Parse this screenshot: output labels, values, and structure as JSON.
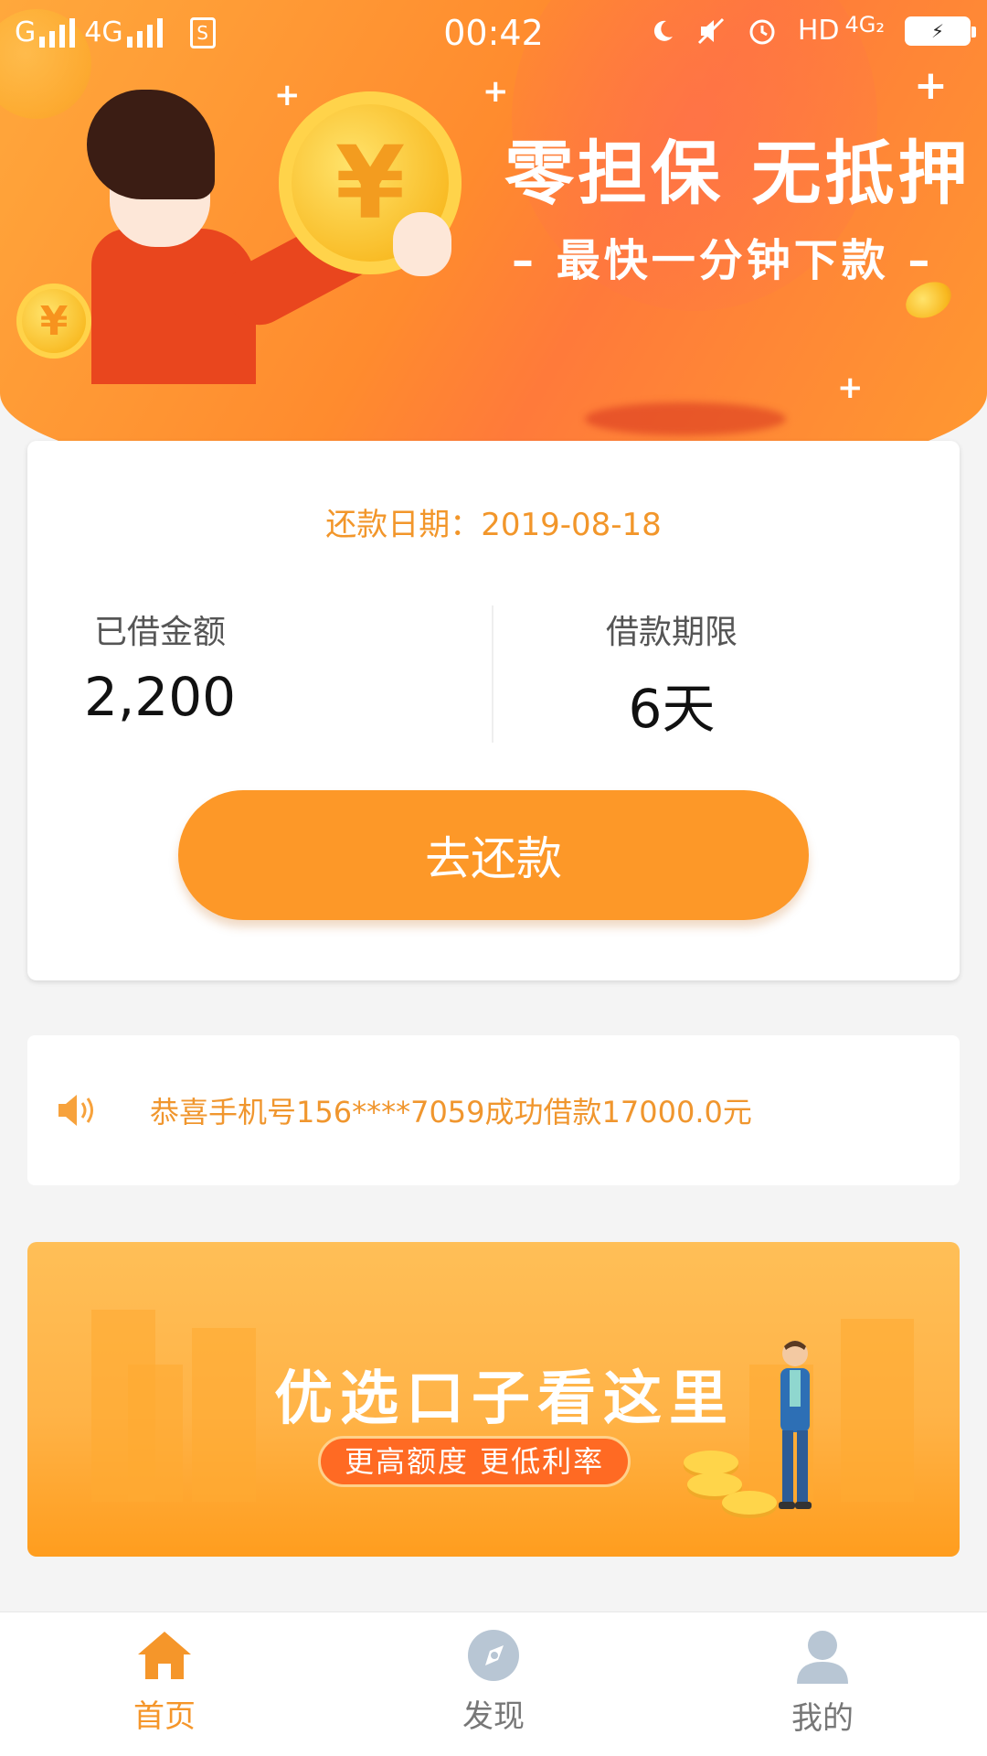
{
  "status_bar": {
    "carrier1": "G",
    "network2": "4G",
    "time": "00:42",
    "hd": "HD",
    "lte": "4G₂",
    "sim_badge": "S"
  },
  "hero": {
    "title": "零担保 无抵押",
    "subtitle": "– 最快一分钟下款 –",
    "coin_symbol": "¥"
  },
  "loan_card": {
    "due_date_label": "还款日期：",
    "due_date": "2019-08-18",
    "borrowed_label": "已借金额",
    "borrowed_amount": "2,200",
    "term_label": "借款期限",
    "term_value": "6天",
    "repay_button": "去还款"
  },
  "notice": {
    "text": "恭喜手机号156****7059成功借款17000.0元"
  },
  "promo": {
    "title": "优选口子看这里",
    "tagline": "更高额度 更低利率"
  },
  "tabs": [
    {
      "label": "首页",
      "icon": "home-icon",
      "active": true
    },
    {
      "label": "发现",
      "icon": "compass-icon",
      "active": false
    },
    {
      "label": "我的",
      "icon": "user-icon",
      "active": false
    }
  ],
  "colors": {
    "accent": "#fd9828",
    "accent_text": "#f2962a",
    "inactive_tab": "#b8c6d4"
  }
}
